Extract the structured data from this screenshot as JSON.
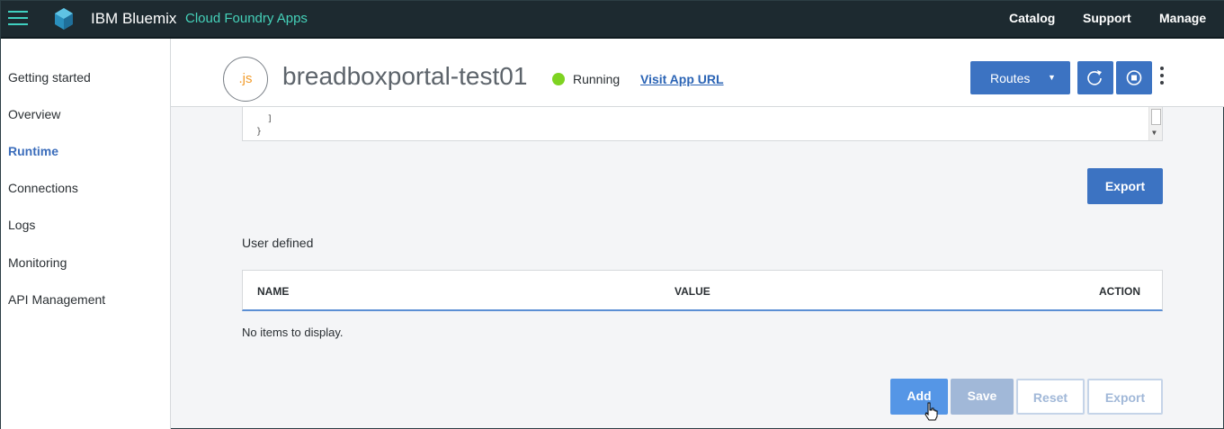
{
  "topbar": {
    "brand": "IBM Bluemix",
    "section": "Cloud Foundry Apps",
    "nav": [
      "Catalog",
      "Support",
      "Manage"
    ]
  },
  "sidebar": {
    "items": [
      {
        "label": "Getting started",
        "active": false
      },
      {
        "label": "Overview",
        "active": false
      },
      {
        "label": "Runtime",
        "active": true
      },
      {
        "label": "Connections",
        "active": false
      },
      {
        "label": "Logs",
        "active": false
      },
      {
        "label": "Monitoring",
        "active": false
      },
      {
        "label": "API Management",
        "active": false
      }
    ]
  },
  "app": {
    "icon_text": ".js",
    "name": "breadboxportal-test01",
    "status": "Running",
    "status_color": "#7ed321",
    "visit_link": "Visit App URL",
    "routes_label": "Routes"
  },
  "code": {
    "line1": "]",
    "line2": "}"
  },
  "export_label": "Export",
  "user_defined": {
    "title": "User defined",
    "columns": [
      "NAME",
      "VALUE",
      "ACTION"
    ],
    "empty_message": "No items to display."
  },
  "actions": {
    "add": "Add",
    "save": "Save",
    "reset": "Reset",
    "export": "Export"
  },
  "colors": {
    "accent": "#3c73c2",
    "topbar": "#1d2a30",
    "brand_teal": "#45d1b9"
  }
}
